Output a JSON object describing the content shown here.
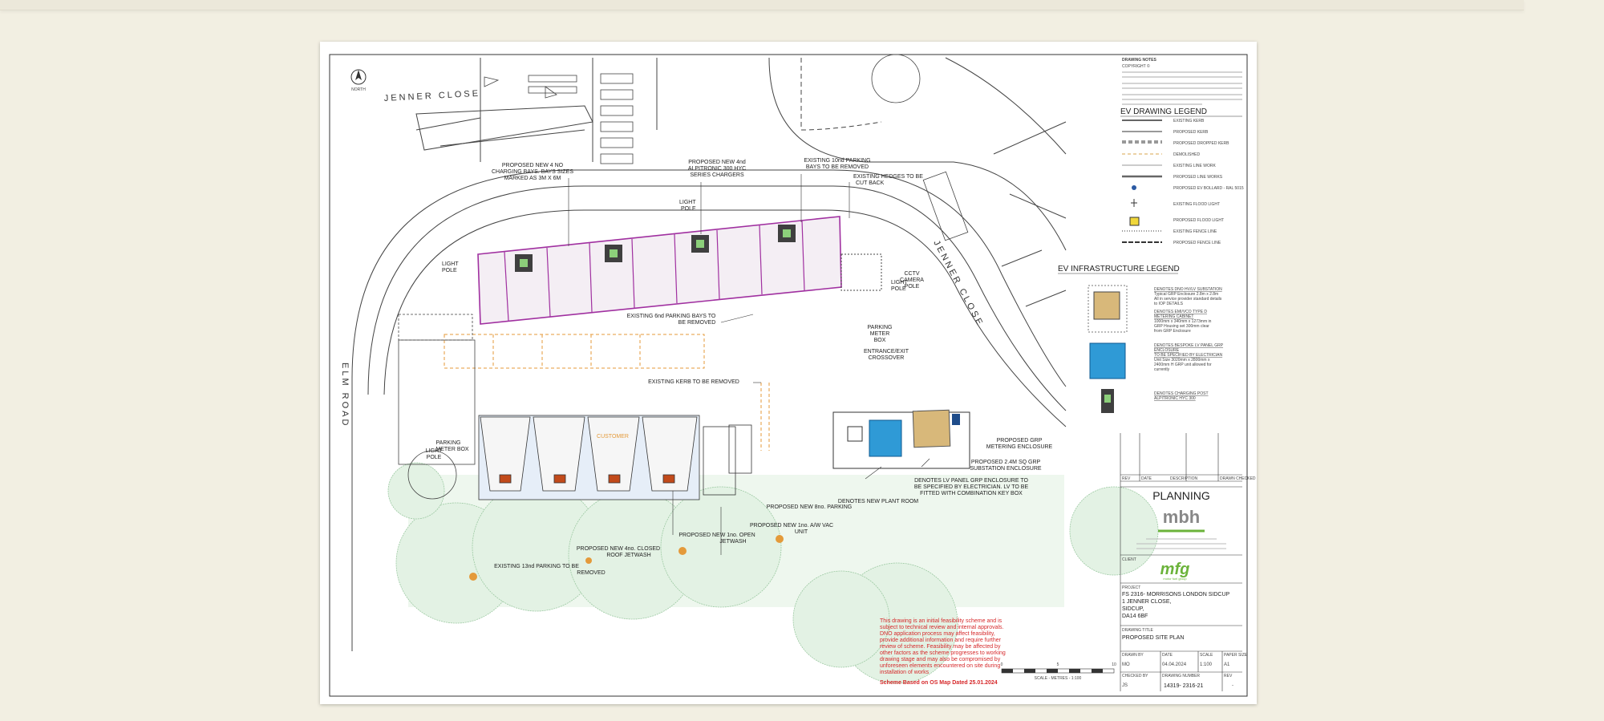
{
  "drawing": {
    "north": "NORTH",
    "roads": {
      "jenner_close_top": "JENNER CLOSE",
      "jenner_close_right": "JENNER CLOSE",
      "elm_road": "ELM ROAD"
    },
    "notes_heading": "DRAWING NOTES",
    "copyright": "COPYRIGHT ©"
  },
  "annotations": {
    "proposed_charging_bays": [
      "PROPOSED NEW 4 NO",
      "CHARGING BAYS. BAYS SIZES",
      "MARKED AS 3M X 6M"
    ],
    "proposed_alpitronic": [
      "PROPOSED NEW 4nd",
      "ALPITRONIC 300 HYC",
      "SERIES CHARGERS"
    ],
    "existing_bays_removed": [
      "EXISTING 10nd PARKING",
      "BAYS TO BE REMOVED"
    ],
    "existing_hedges": [
      "EXISTING HEDGES TO BE",
      "CUT BACK"
    ],
    "light_pole_top": [
      "LIGHT",
      "POLE"
    ],
    "light_pole_left": [
      "LIGHT",
      "POLE"
    ],
    "light_pole_right": [
      "LIGHT",
      "POLE"
    ],
    "cctv": [
      "CCTV",
      "CAMERA",
      "POLE"
    ],
    "existing_bays_mid": [
      "EXISTING 6nd PARKING BAYS TO",
      "BE REMOVED"
    ],
    "parking_meter": [
      "PARKING",
      "METER",
      "BOX"
    ],
    "crossover": [
      "ENTRANCE/EXIT",
      "CROSSOVER"
    ],
    "kerb_removed": "EXISTING KERB TO BE REMOVED",
    "parking_left": [
      "PARKING",
      "METER BOX"
    ],
    "light_pole_bottom": [
      "LIGHT",
      "POLE"
    ],
    "grp_metering": [
      "PROPOSED GRP",
      "METERING ENCLOSURE"
    ],
    "grp_substation": [
      "PROPOSED 2.4M SQ GRP",
      "SUBSTATION ENCLOSURE"
    ],
    "lv_panel": [
      "DENOTES LV PANEL GRP ENCLOSURE TO",
      "BE SPECIFIED BY ELECTRICIAN. LV TO BE",
      "FITTED WITH COMBINATION KEY BOX"
    ],
    "plant_room": "DENOTES NEW PLANT ROOM",
    "proposed_parking": "PROPOSED NEW 8no. PARKING",
    "air_vac": [
      "PROPOSED NEW 1no. A/W VAC",
      "UNIT"
    ],
    "open_jetwash": [
      "PROPOSED NEW 1no. OPEN",
      "JETWASH"
    ],
    "closed_jetwash": [
      "PROPOSED NEW 4no. CLOSED",
      "ROOF JETWASH"
    ],
    "existing_parking_removed": [
      "EXISTING 13nd PARKING TO BE",
      "REMOVED"
    ],
    "customer_building": "CUSTOMER"
  },
  "ev_legend": {
    "title": "EV DRAWING LEGEND",
    "items": [
      "EXISTING KERB",
      "PROPOSED KERB",
      "PROPOSED DROPPED KERB",
      "DEMOLISHED",
      "EXISTING LINE WORK",
      "PROPOSED LINE WORKS",
      "PROPOSED EV BOLLARD - RAL 5015",
      "EXISTING FLOOD LIGHT",
      "PROPOSED FLOOD LIGHT",
      "EXISTING FENCE LINE",
      "PROPOSED FENCE LINE"
    ]
  },
  "infra_legend": {
    "title": "EV INFRASTRUCTURE LEGEND",
    "items": [
      {
        "title": "DENOTES DNO HV/LV SUBSTATION",
        "text": [
          "Typical GRP Enclosure 2.8m x 2.8m",
          "All in service provider standard details",
          "to IOP DETAILS"
        ]
      },
      {
        "title": "DENOTES EMI/VCO TYPE D",
        "text": [
          "METERING CABINET",
          "1000mm x 340mm x 1273mm in",
          "GRP Housing set 300mm clear",
          "from GRP Enclosure"
        ]
      },
      {
        "title": "DENOTES BESPOKE LV PANEL GRP",
        "text": [
          "ENCLOSURE",
          "TO BE SPECIFIED BY ELECTRICIAN",
          "Unit Size 3020mm x 2800mm x",
          "2400mm H GRP unit allowed for",
          "currently"
        ]
      },
      {
        "title": "DENOTES CHARGING POST",
        "text": [
          "ALPITRONIC HYC 300"
        ]
      }
    ]
  },
  "disclaimer": {
    "text": [
      "This drawing is an initial feasibility scheme and is",
      "subject to technical review and internal approvals.",
      "DNO application process may affect feasibility,",
      "provide additional information and require further",
      "review of scheme. Feasibility may be affected by",
      "other factors as the scheme progresses to working",
      "drawing stage and may also be compromised by",
      "unforeseen elements encountered on site during",
      "installation of works"
    ],
    "scheme_note": "Scheme Based on OS Map  Dated 25.01.2024"
  },
  "scale_bar": {
    "ticks": [
      "0",
      "5",
      "10"
    ],
    "label": "SCALE - METRES - 1:100"
  },
  "title_block": {
    "rev_headers": [
      "REV",
      "DATE",
      "DESCRIPTION",
      "DRAWN CHECKED"
    ],
    "stage": "PLANNING",
    "company": "mbh",
    "client_label": "CLIENT",
    "client": "mfg",
    "client_sub": "motor fuel group",
    "project_label": "PROJECT",
    "project": [
      "FS 2316- MORRISONS LONDON SIDCUP",
      "1 JENNER CLOSE,",
      "SIDCUP,",
      "DA14 6BF"
    ],
    "drawing_title_label": "DRAWING TITLE",
    "drawing_title": "PROPOSED SITE PLAN",
    "drawn_by_label": "DRAWN BY",
    "drawn_by": "MO",
    "date_label": "DATE",
    "date": "04.04.2024",
    "scale_label": "SCALE",
    "scale": "1:100",
    "paper_label": "PAPER SIZE",
    "paper": "A1",
    "checked_label": "CHECKED BY",
    "checked": "JS",
    "drawing_no_label": "DRAWING NUMBER",
    "drawing_no": "14319- 2316-21",
    "rev_label": "REV",
    "rev": "-"
  },
  "colors": {
    "boundary": "#a030a0",
    "grp": "#d8b87a",
    "lv_panel": "#2f9ad6",
    "tree": "#dcefe0",
    "orange": "#e49a3a",
    "green": "#6bb33a"
  }
}
